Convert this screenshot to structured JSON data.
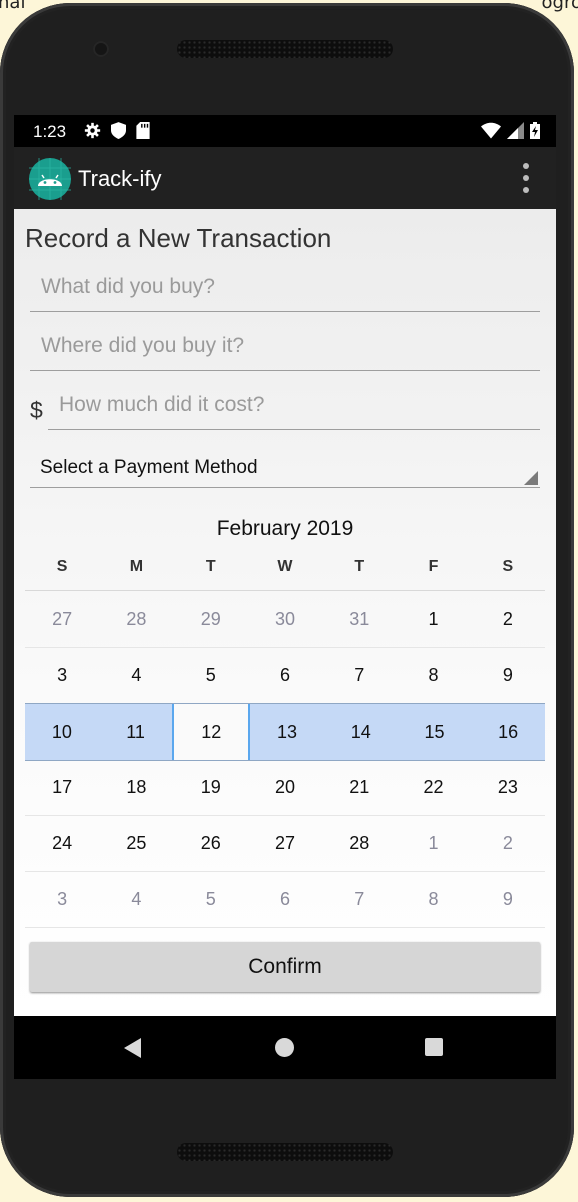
{
  "background": {
    "left_text": "nal",
    "right_text": "ogro"
  },
  "statusbar": {
    "time": "1:23",
    "icons_left": [
      "gear-icon",
      "shield-icon",
      "sd-card-icon"
    ],
    "icons_right": [
      "wifi-icon",
      "signal-icon",
      "battery-charging-icon"
    ]
  },
  "appbar": {
    "title": "Track-ify",
    "logo": "android-icon",
    "menu": "overflow-menu-icon"
  },
  "form": {
    "heading": "Record a New Transaction",
    "what_placeholder": "What did you buy?",
    "where_placeholder": "Where did you buy it?",
    "currency_symbol": "$",
    "cost_placeholder": "How much did it cost?",
    "payment_label": "Select a Payment Method"
  },
  "calendar": {
    "month_label": "February 2019",
    "weekdays": [
      "S",
      "M",
      "T",
      "W",
      "T",
      "F",
      "S"
    ],
    "weeks": [
      [
        {
          "d": "27",
          "o": true
        },
        {
          "d": "28",
          "o": true
        },
        {
          "d": "29",
          "o": true
        },
        {
          "d": "30",
          "o": true
        },
        {
          "d": "31",
          "o": true
        },
        {
          "d": "1"
        },
        {
          "d": "2"
        }
      ],
      [
        {
          "d": "3"
        },
        {
          "d": "4"
        },
        {
          "d": "5"
        },
        {
          "d": "6"
        },
        {
          "d": "7"
        },
        {
          "d": "8"
        },
        {
          "d": "9"
        }
      ],
      [
        {
          "d": "10"
        },
        {
          "d": "11"
        },
        {
          "d": "12",
          "today": true
        },
        {
          "d": "13"
        },
        {
          "d": "14"
        },
        {
          "d": "15"
        },
        {
          "d": "16"
        }
      ],
      [
        {
          "d": "17"
        },
        {
          "d": "18"
        },
        {
          "d": "19"
        },
        {
          "d": "20"
        },
        {
          "d": "21"
        },
        {
          "d": "22"
        },
        {
          "d": "23"
        }
      ],
      [
        {
          "d": "24"
        },
        {
          "d": "25"
        },
        {
          "d": "26"
        },
        {
          "d": "27"
        },
        {
          "d": "28"
        },
        {
          "d": "1",
          "o": true
        },
        {
          "d": "2",
          "o": true
        }
      ],
      [
        {
          "d": "3",
          "o": true
        },
        {
          "d": "4",
          "o": true
        },
        {
          "d": "5",
          "o": true
        },
        {
          "d": "6",
          "o": true
        },
        {
          "d": "7",
          "o": true
        },
        {
          "d": "8",
          "o": true
        },
        {
          "d": "9",
          "o": true
        }
      ]
    ],
    "selected_week_index": 2,
    "colors": {
      "selected_week": "#c5d9f6",
      "today_border": "#5aa7ee",
      "other_month": "#8a8a9a"
    }
  },
  "confirm_label": "Confirm",
  "navbar": {
    "back": "back-icon",
    "home": "home-icon",
    "recents": "recents-icon"
  },
  "colors": {
    "appbar": "#212121",
    "logo_bg": "#1a9e8e",
    "button_bg": "#d6d6d6"
  }
}
